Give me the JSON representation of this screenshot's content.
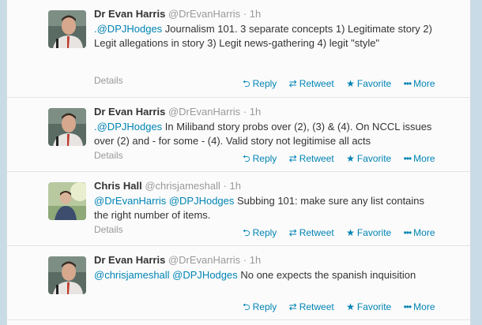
{
  "colors": {
    "link": "#0084b4",
    "name": "#333333",
    "meta": "#999999",
    "background": "#c8dbe6"
  },
  "actions": {
    "reply": "Reply",
    "reply_icon": "reply-arrow-icon",
    "retweet": "Retweet",
    "retweet_icon": "retweet-arrows-icon",
    "favorite": "Favorite",
    "favorite_icon": "star-icon",
    "more": "More",
    "more_icon": "dots-icon",
    "details": "Details"
  },
  "tweets": [
    {
      "name": "Dr Evan Harris",
      "handle": "@DrEvanHarris",
      "time": "1h",
      "mentions": ".@DPJHodges",
      "text": " Journalism 101. 3 separate concepts 1) Legitimate story 2) Legit allegations in story 3) Legit news-gathering 4) legit \"style\""
    },
    {
      "name": "Dr Evan Harris",
      "handle": "@DrEvanHarris",
      "time": "1h",
      "mentions": ".@DPJHodges",
      "text": " In Miliband story probs over (2), (3) & (4). On NCCL issues over (2) and - for some - (4). Valid story not legitimise all acts"
    },
    {
      "name": "Chris Hall",
      "handle": "@chrisjameshall",
      "time": "1h",
      "mentions": "@DrEvanHarris @DPJHodges",
      "text": " Subbing 101: make sure any list contains the right number of items."
    },
    {
      "name": "Dr Evan Harris",
      "handle": "@DrEvanHarris",
      "time": "1h",
      "mentions": "@chrisjameshall @DPJHodges",
      "text": " No one expects the spanish inquisition"
    }
  ]
}
